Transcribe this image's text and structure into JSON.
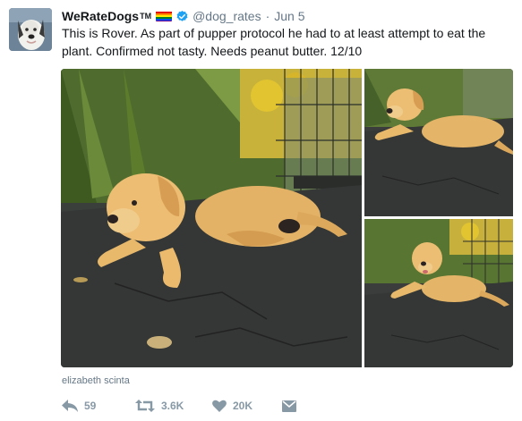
{
  "tweet": {
    "display_name": "WeRateDogs",
    "tm": "TM",
    "handle": "@dog_rates",
    "separator": "·",
    "date": "Jun 5",
    "text": "This is Rover. As part of pupper protocol he had to at least attempt to eat the plant. Confirmed not tasty. Needs peanut butter. 12/10",
    "photo_credit": "elizabeth scinta"
  },
  "actions": {
    "replies": "59",
    "retweets": "3.6K",
    "likes": "20K"
  },
  "icons": {
    "avatar": "dog-avatar",
    "flag": "rainbow-flag-icon",
    "verified": "verified-badge-icon",
    "reply": "reply-icon",
    "retweet": "retweet-icon",
    "like": "heart-icon",
    "message": "envelope-icon"
  },
  "colors": {
    "text": "#14171a",
    "secondary": "#657786",
    "action_gray": "#8899a6",
    "verified_blue": "#1da1f2"
  }
}
